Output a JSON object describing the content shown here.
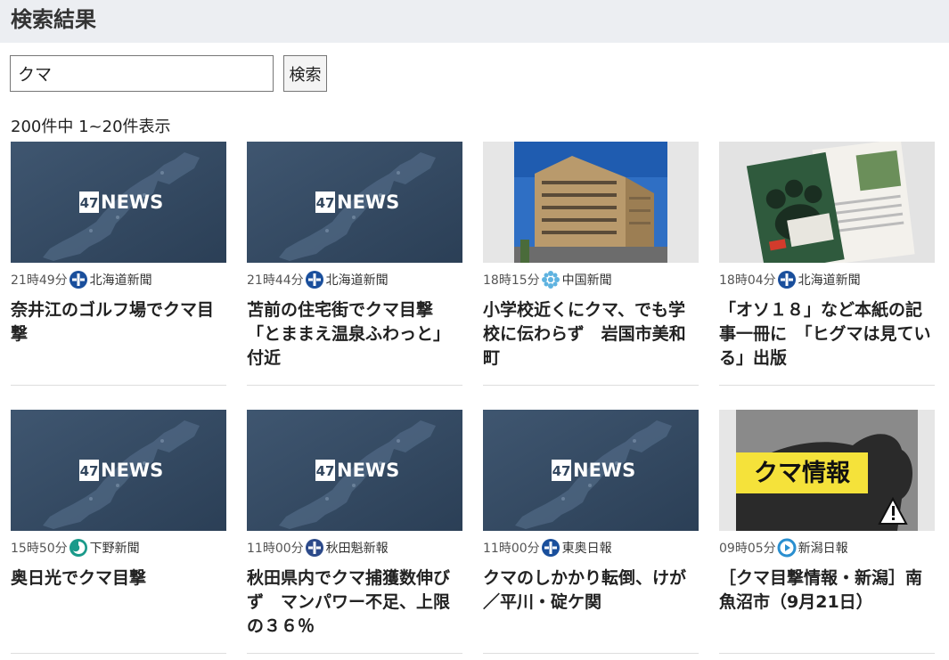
{
  "page": {
    "title": "検索結果"
  },
  "search": {
    "value": "クマ",
    "button_label": "検索"
  },
  "results": {
    "summary": "200件中 1~20件表示"
  },
  "brand_colors": {
    "hokkaido": "#1a4f9c",
    "chugoku": "#5fb3e0",
    "shimotsuke": "#1a9a8a",
    "akita": "#2c4a8a",
    "too": "#1a4f9c",
    "niigata": "#2a8fd0"
  },
  "articles": [
    {
      "time": "21時49分",
      "source": "北海道新聞",
      "source_icon": "hokkaido-shimbun-logo-icon",
      "title": "奈井江のゴルフ場でクマ目撃",
      "thumb": "47news",
      "thumb_text": "47NEWS"
    },
    {
      "time": "21時44分",
      "source": "北海道新聞",
      "source_icon": "hokkaido-shimbun-logo-icon",
      "title": "苫前の住宅街でクマ目撃「とままえ温泉ふわっと」付近",
      "thumb": "47news",
      "thumb_text": "47NEWS"
    },
    {
      "time": "18時15分",
      "source": "中国新聞",
      "source_icon": "chugoku-shimbun-logo-icon",
      "title": "小学校近くにクマ、でも学校に伝わらず　岩国市美和町",
      "thumb": "school-building"
    },
    {
      "time": "18時04分",
      "source": "北海道新聞",
      "source_icon": "hokkaido-shimbun-logo-icon",
      "title": "「オソ１８」など本紙の記事一冊に　「ヒグマは見ている」出版",
      "thumb": "book"
    },
    {
      "time": "15時50分",
      "source": "下野新聞",
      "source_icon": "shimotsuke-shimbun-logo-icon",
      "title": "奥日光でクマ目撃",
      "thumb": "47news",
      "thumb_text": "47NEWS"
    },
    {
      "time": "11時00分",
      "source": "秋田魁新報",
      "source_icon": "akita-sakigake-logo-icon",
      "title": "秋田県内でクマ捕獲数伸びず　マンパワー不足、上限の３６％",
      "thumb": "47news",
      "thumb_text": "47NEWS"
    },
    {
      "time": "11時00分",
      "source": "東奥日報",
      "source_icon": "too-nippo-logo-icon",
      "title": "クマのしかかり転倒、けが／平川・碇ケ関",
      "thumb": "47news",
      "thumb_text": "47NEWS"
    },
    {
      "time": "09時05分",
      "source": "新潟日報",
      "source_icon": "niigata-nippo-logo-icon",
      "title": "［クマ目撃情報・新潟］南魚沼市（9月21日）",
      "thumb": "bear-warning",
      "thumb_text": "クマ情報"
    }
  ]
}
